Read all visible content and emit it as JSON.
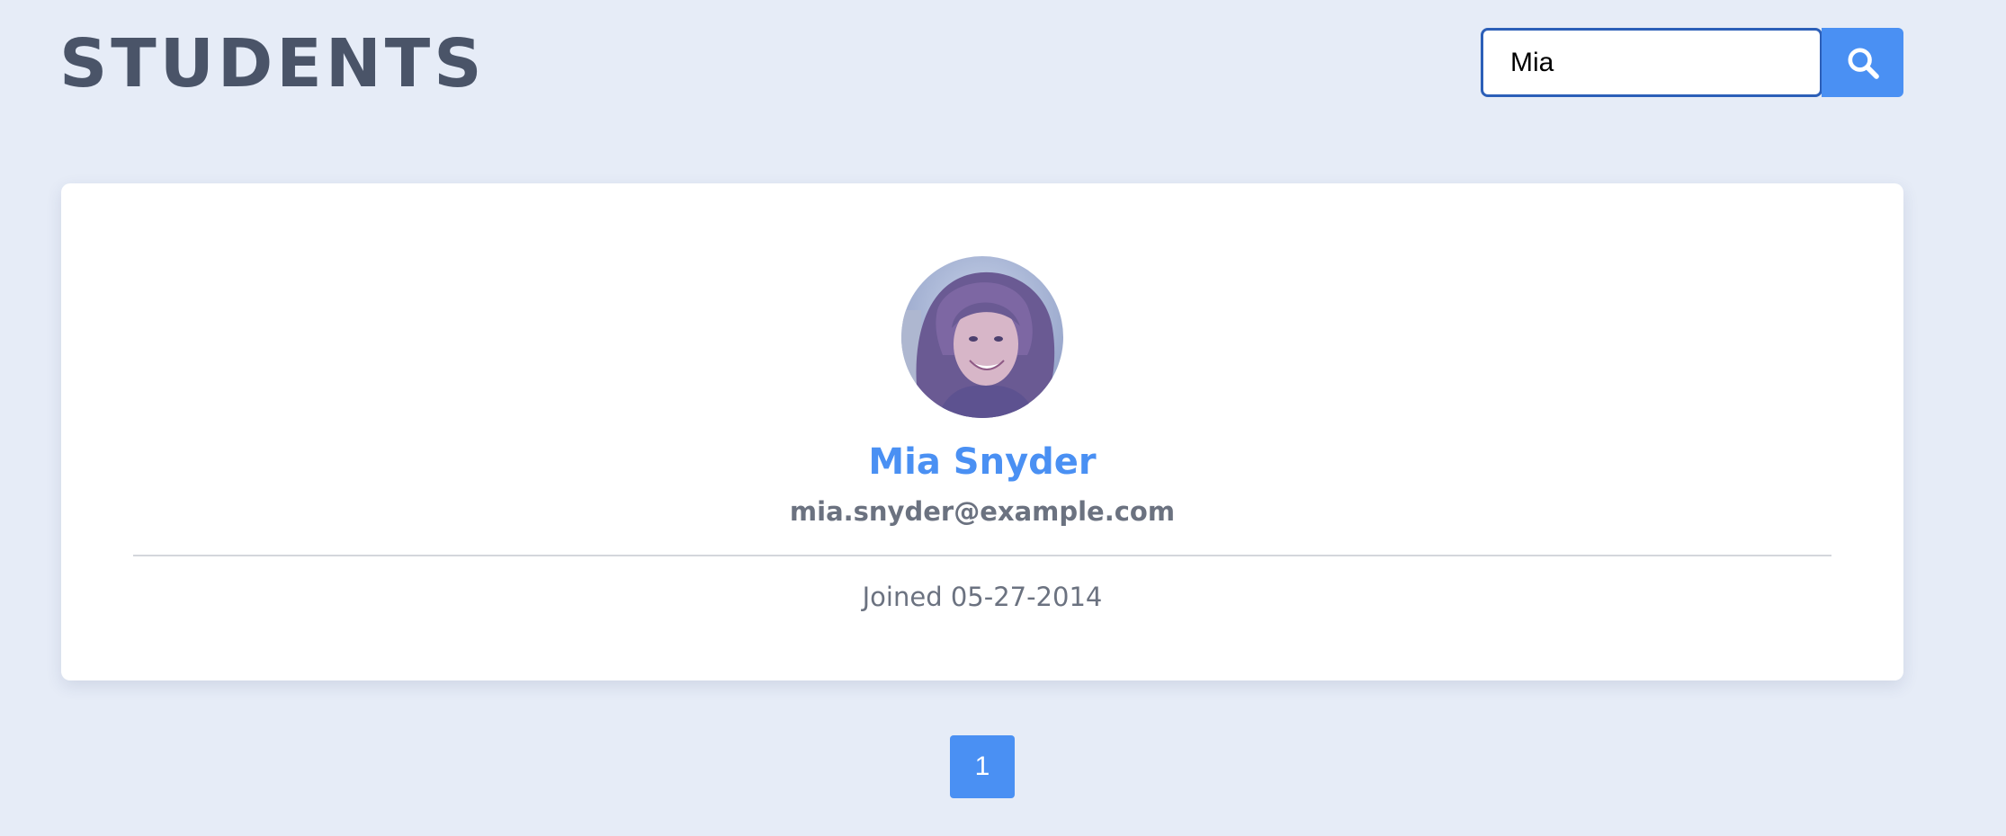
{
  "header": {
    "title": "STUDENTS"
  },
  "search": {
    "value": "Mia",
    "button_icon": "search-icon"
  },
  "student": {
    "name": "Mia Snyder",
    "email": "mia.snyder@example.com",
    "joined": "Joined 05-27-2014",
    "avatar_alt": "Mia Snyder"
  },
  "pagination": {
    "pages": [
      "1"
    ],
    "current": "1"
  },
  "colors": {
    "background": "#e6ecf7",
    "accent": "#4a90f3",
    "title": "#4a5468",
    "muted_text": "#6b7280",
    "input_border": "#2c5fb8"
  }
}
